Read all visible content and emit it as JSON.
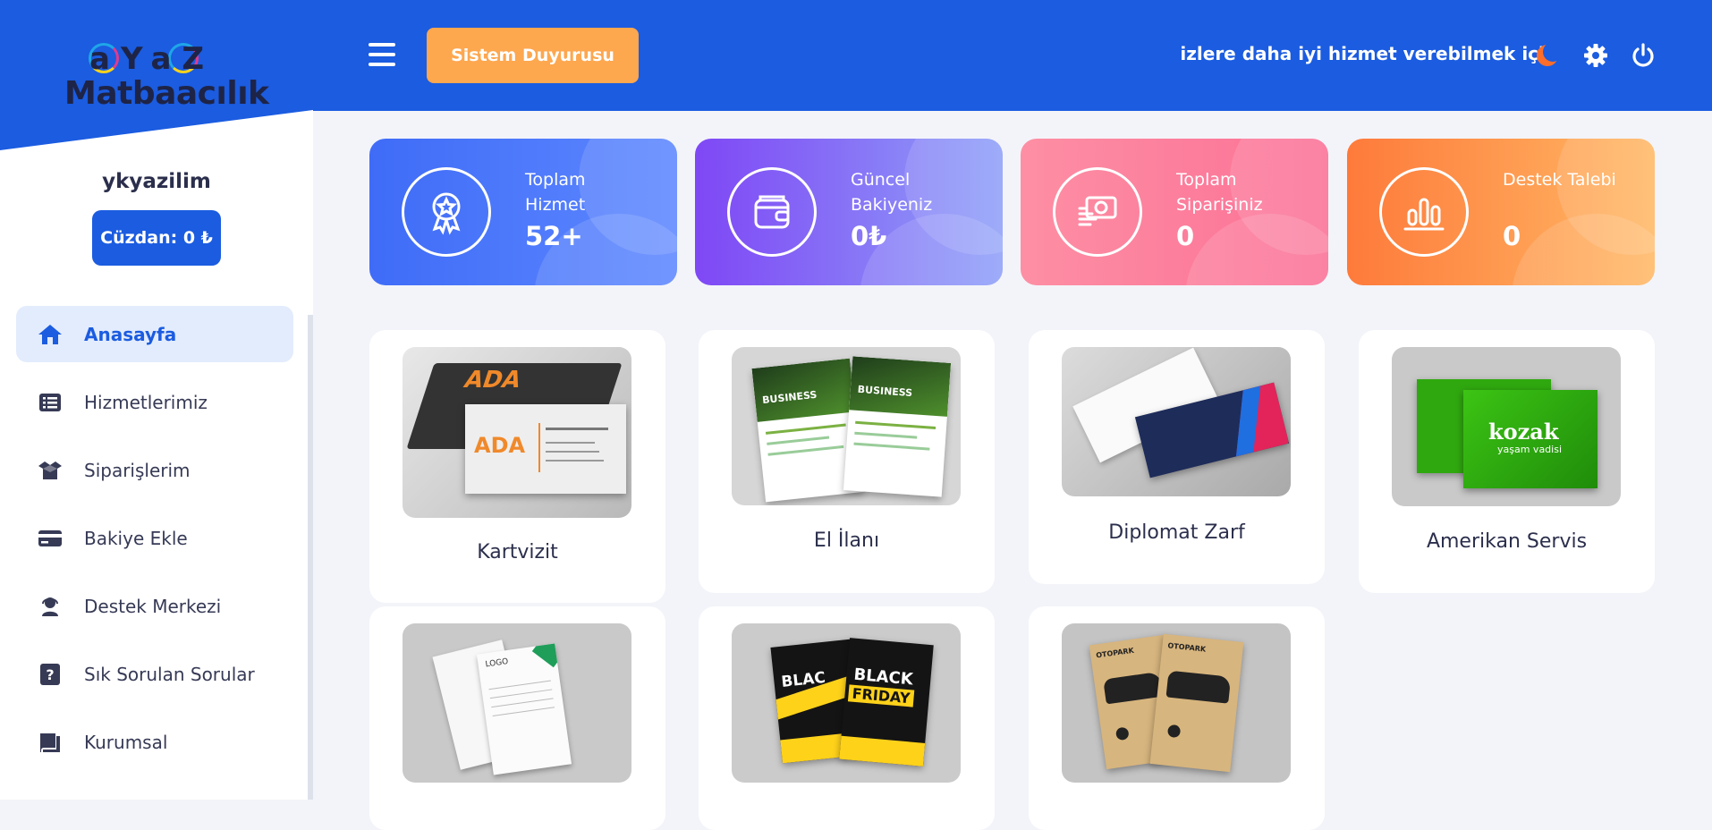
{
  "brand": {
    "logo_top": "aYaZ",
    "logo_bottom": "Matbaacılık"
  },
  "user": {
    "name": "ykyazilim",
    "wallet_label": "Cüzdan: 0 ₺"
  },
  "nav": [
    {
      "label": "Anasayfa",
      "icon": "home-icon",
      "active": true
    },
    {
      "label": "Hizmetlerimiz",
      "icon": "list-icon"
    },
    {
      "label": "Siparişlerim",
      "icon": "box-icon"
    },
    {
      "label": "Bakiye Ekle",
      "icon": "credit-card-icon"
    },
    {
      "label": "Destek Merkezi",
      "icon": "headset-icon"
    },
    {
      "label": "Sık Sorulan Sorular",
      "icon": "question-icon"
    },
    {
      "label": "Kurumsal",
      "icon": "book-icon"
    }
  ],
  "topbar": {
    "announce_button": "Sistem Duyurusu",
    "marquee": "Sizlere daha iyi hizmet verebilmek için",
    "icons": [
      "moon-icon",
      "gear-icon",
      "power-icon"
    ]
  },
  "stats": [
    {
      "label": "Toplam Hizmet",
      "value": "52+",
      "icon": "award-icon",
      "color_from": "#3f6cf7",
      "color_to": "#5d87ff"
    },
    {
      "label": "Güncel Bakiyeniz",
      "value": "0₺",
      "icon": "wallet-icon",
      "color_from": "#7f47f5",
      "color_to": "#8fa0f8"
    },
    {
      "label": "Toplam Siparişiniz",
      "value": "0",
      "icon": "money-icon",
      "color_from": "#fd8fa4",
      "color_to": "#fb7096"
    },
    {
      "label": "Destek Talebi",
      "value": "0",
      "icon": "chart-icon",
      "color_from": "#fe7a3b",
      "color_to": "#ffb865"
    }
  ],
  "products": [
    {
      "title": "Kartvizit",
      "art": "ADA"
    },
    {
      "title": "El İlanı",
      "art": "BUSINESS"
    },
    {
      "title": "Diplomat Zarf",
      "art": "envelope"
    },
    {
      "title": "Amerikan Servis",
      "art": "kozak"
    },
    {
      "title": "",
      "art": "LOGO"
    },
    {
      "title": "",
      "art": "BLACK FRIDAY"
    },
    {
      "title": "",
      "art": "OTOPARK"
    }
  ],
  "colors": {
    "primary": "#1b5ce0",
    "accent": "#fda74f",
    "moon": "#fd6e2b"
  }
}
